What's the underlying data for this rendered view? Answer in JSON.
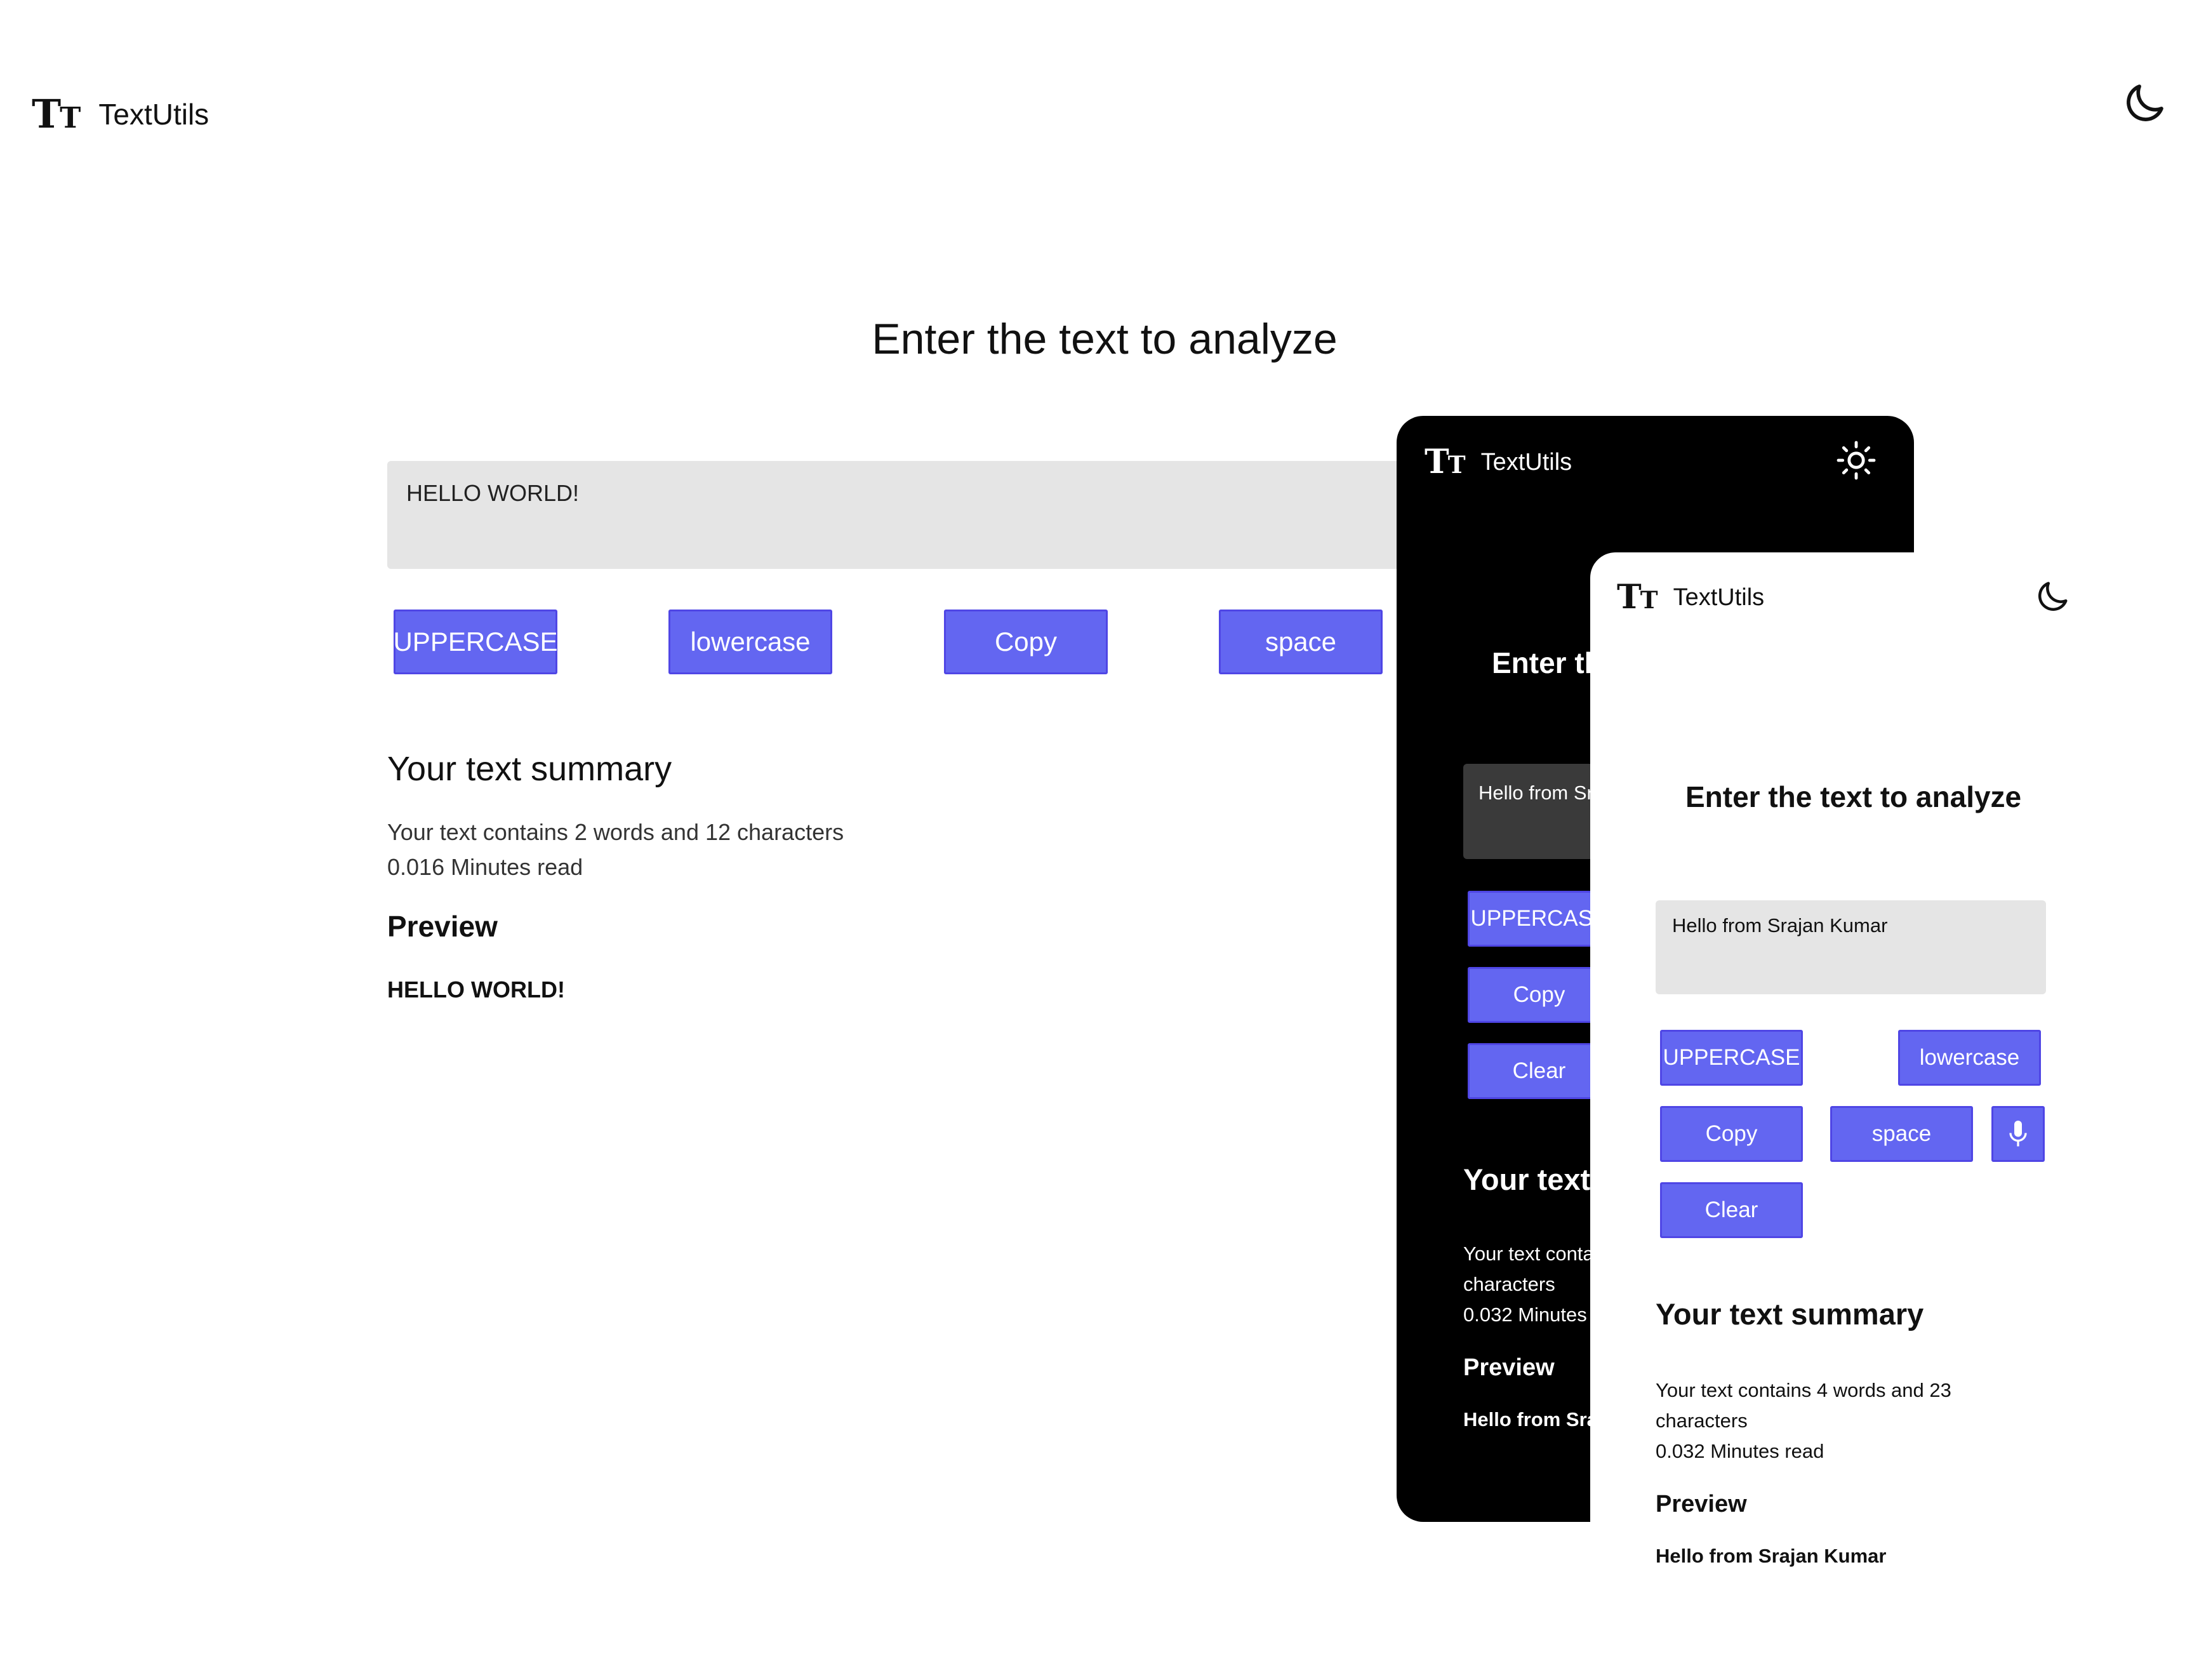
{
  "main": {
    "app_name": "TextUtils",
    "logo_icon": "text-size-icon",
    "theme_icon": "moon-icon",
    "title": "Enter the text to analyze",
    "textarea_value": "HELLO WORLD!",
    "buttons": [
      "UPPERCASE",
      "lowercase",
      "Copy",
      "space"
    ],
    "summary_heading": "Your text summary",
    "summary_line1": "Your text contains 2 words and 12 characters",
    "summary_line2": "0.016 Minutes read",
    "preview_heading": "Preview",
    "preview_text": "HELLO WORLD!"
  },
  "dark_phone": {
    "app_name": "TextUtils",
    "theme_icon": "sun-icon",
    "title": "Enter the text to analyze",
    "textarea_value": "Hello from Srajan Kumar",
    "buttons": [
      "UPPERCASE",
      "Copy",
      "Clear"
    ],
    "summary_heading": "Your text summary",
    "summary_line1": "Your text contains 4 words and 23",
    "summary_line2": "characters",
    "summary_line3": "0.032 Minutes read",
    "preview_heading": "Preview",
    "preview_text": "Hello from Srajan Kumar"
  },
  "light_phone": {
    "app_name": "TextUtils",
    "theme_icon": "moon-icon",
    "title": "Enter the text to analyze",
    "textarea_value": "Hello from Srajan Kumar",
    "buttons": {
      "uppercase": "UPPERCASE",
      "lowercase": "lowercase",
      "copy": "Copy",
      "space": "space",
      "mic_icon": "microphone-icon",
      "clear": "Clear"
    },
    "summary_heading": "Your text summary",
    "summary_line1": "Your text contains 4 words and 23",
    "summary_line2": "characters",
    "summary_line3": "0.032 Minutes read",
    "preview_heading": "Preview",
    "preview_text": "Hello from Srajan Kumar"
  },
  "colors": {
    "button": "#6366f1",
    "dark_background": "#000000",
    "textarea_light": "#e5e5e5",
    "textarea_dark": "#3a3a3a"
  }
}
